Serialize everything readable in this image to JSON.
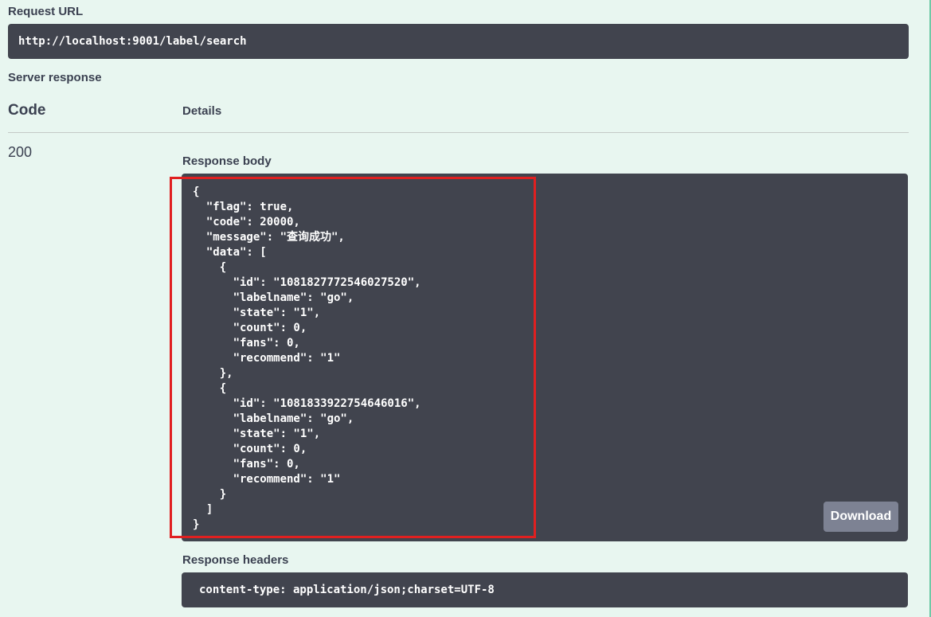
{
  "request_url": {
    "label": "Request URL",
    "value": "http://localhost:9001/label/search"
  },
  "server_response": {
    "label": "Server response",
    "columns": {
      "code": "Code",
      "details": "Details"
    },
    "status_code": "200",
    "response_body": {
      "label": "Response body",
      "content": "{\n  \"flag\": true,\n  \"code\": 20000,\n  \"message\": \"查询成功\",\n  \"data\": [\n    {\n      \"id\": \"1081827772546027520\",\n      \"labelname\": \"go\",\n      \"state\": \"1\",\n      \"count\": 0,\n      \"fans\": 0,\n      \"recommend\": \"1\"\n    },\n    {\n      \"id\": \"1081833922754646016\",\n      \"labelname\": \"go\",\n      \"state\": \"1\",\n      \"count\": 0,\n      \"fans\": 0,\n      \"recommend\": \"1\"\n    }\n  ]\n}",
      "download_label": "Download"
    },
    "response_headers": {
      "label": "Response headers",
      "content": "content-type: application/json;charset=UTF-8"
    }
  },
  "colors": {
    "page_background": "#e8f6f0",
    "code_background": "#41444e",
    "highlight": "#e02020",
    "download_button": "#7d8293"
  }
}
